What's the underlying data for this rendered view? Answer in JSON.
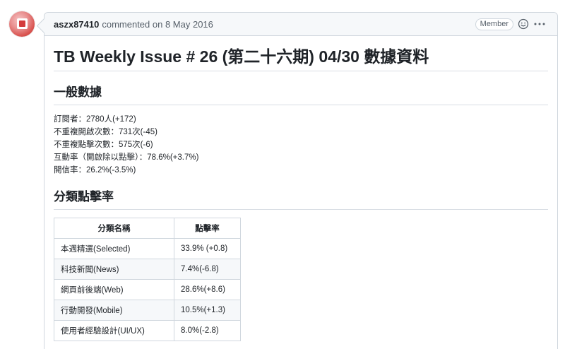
{
  "comment": {
    "author": "aszx87410",
    "meta": "commented on 8 May 2016",
    "badge": "Member",
    "actions": {
      "reaction_icon": "smiley-icon",
      "more_icon": "kebab-horizontal-icon"
    }
  },
  "post": {
    "title": "TB Weekly Issue # 26 (第二十六期) 04/30 數據資料",
    "sections": [
      {
        "heading": "一般數據",
        "lines": [
          "訂閱者：2780人(+172)",
          "不重複開啟次數：731次(-45)",
          "不重複點擊次數：575次(-6)",
          "互動率（開啟除以點擊）：78.6%(+3.7%)",
          "開信率：26.2%(-3.5%)"
        ]
      },
      {
        "heading": "分類點擊率",
        "table": {
          "headers": [
            "分類名稱",
            "點擊率"
          ],
          "rows": [
            [
              "本週精選(Selected)",
              "33.9% (+0.8)"
            ],
            [
              "科技新聞(News)",
              "7.4%(-6.8)"
            ],
            [
              "網頁前後端(Web)",
              "28.6%(+8.6)"
            ],
            [
              "行動開發(Mobile)",
              "10.5%(+1.3)"
            ],
            [
              "使用者經驗設計(UI/UX)",
              "8.0%(-2.8)"
            ]
          ]
        }
      }
    ]
  }
}
